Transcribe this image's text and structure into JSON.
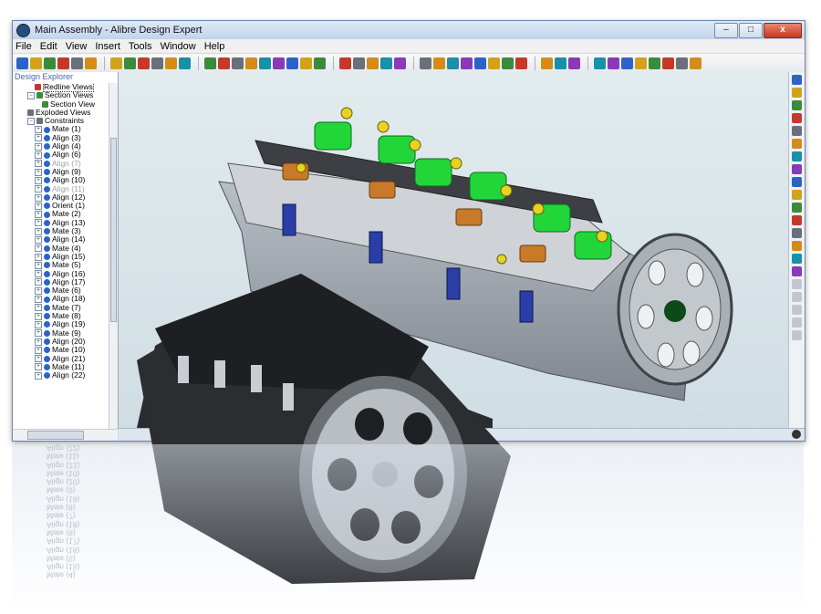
{
  "window": {
    "title": "Main Assembly - Alibre Design Expert",
    "controls": {
      "minimize": "–",
      "maximize": "□",
      "close": "x"
    }
  },
  "menu": [
    "File",
    "Edit",
    "View",
    "Insert",
    "Tools",
    "Window",
    "Help"
  ],
  "explorer": {
    "title": "Design Explorer",
    "items": [
      {
        "label": "Redline Views",
        "icon": "redline-icon",
        "indent": 3,
        "expander": "",
        "state": "selected"
      },
      {
        "label": "Section Views",
        "icon": "section-views-icon",
        "indent": 2,
        "expander": "−",
        "state": ""
      },
      {
        "label": "Section View",
        "icon": "section-view-icon",
        "indent": 4,
        "expander": "",
        "state": ""
      },
      {
        "label": "Exploded Views",
        "icon": "exploded-views-icon",
        "indent": 2,
        "expander": "",
        "state": ""
      },
      {
        "label": "Constraints",
        "icon": "constraints-icon",
        "indent": 2,
        "expander": "−",
        "state": ""
      },
      {
        "label": "Mate (1)",
        "icon": "mate-icon",
        "indent": 3,
        "expander": "+",
        "state": ""
      },
      {
        "label": "Align (3)",
        "icon": "align-icon",
        "indent": 3,
        "expander": "+",
        "state": ""
      },
      {
        "label": "Align (4)",
        "icon": "align-icon",
        "indent": 3,
        "expander": "+",
        "state": ""
      },
      {
        "label": "Align (6)",
        "icon": "align-icon",
        "indent": 3,
        "expander": "+",
        "state": ""
      },
      {
        "label": "Align (7)",
        "icon": "align-icon",
        "indent": 3,
        "expander": "+",
        "state": "dim"
      },
      {
        "label": "Align (9)",
        "icon": "align-icon",
        "indent": 3,
        "expander": "+",
        "state": ""
      },
      {
        "label": "Align (10)",
        "icon": "align-icon",
        "indent": 3,
        "expander": "+",
        "state": ""
      },
      {
        "label": "Align (11)",
        "icon": "align-icon",
        "indent": 3,
        "expander": "+",
        "state": "dim"
      },
      {
        "label": "Align (12)",
        "icon": "align-icon",
        "indent": 3,
        "expander": "+",
        "state": ""
      },
      {
        "label": "Orient (1)",
        "icon": "orient-icon",
        "indent": 3,
        "expander": "+",
        "state": ""
      },
      {
        "label": "Mate (2)",
        "icon": "mate-icon",
        "indent": 3,
        "expander": "+",
        "state": ""
      },
      {
        "label": "Align (13)",
        "icon": "align-icon",
        "indent": 3,
        "expander": "+",
        "state": ""
      },
      {
        "label": "Mate (3)",
        "icon": "mate-icon",
        "indent": 3,
        "expander": "+",
        "state": ""
      },
      {
        "label": "Align (14)",
        "icon": "align-icon",
        "indent": 3,
        "expander": "+",
        "state": ""
      },
      {
        "label": "Mate (4)",
        "icon": "mate-icon",
        "indent": 3,
        "expander": "+",
        "state": ""
      },
      {
        "label": "Align (15)",
        "icon": "align-icon",
        "indent": 3,
        "expander": "+",
        "state": ""
      },
      {
        "label": "Mate (5)",
        "icon": "mate-icon",
        "indent": 3,
        "expander": "+",
        "state": ""
      },
      {
        "label": "Align (16)",
        "icon": "align-icon",
        "indent": 3,
        "expander": "+",
        "state": ""
      },
      {
        "label": "Align (17)",
        "icon": "align-icon",
        "indent": 3,
        "expander": "+",
        "state": ""
      },
      {
        "label": "Mate (6)",
        "icon": "mate-icon",
        "indent": 3,
        "expander": "+",
        "state": ""
      },
      {
        "label": "Align (18)",
        "icon": "align-icon",
        "indent": 3,
        "expander": "+",
        "state": ""
      },
      {
        "label": "Mate (7)",
        "icon": "mate-icon",
        "indent": 3,
        "expander": "+",
        "state": ""
      },
      {
        "label": "Mate (8)",
        "icon": "mate-icon",
        "indent": 3,
        "expander": "+",
        "state": ""
      },
      {
        "label": "Align (19)",
        "icon": "align-icon",
        "indent": 3,
        "expander": "+",
        "state": ""
      },
      {
        "label": "Mate (9)",
        "icon": "mate-icon",
        "indent": 3,
        "expander": "+",
        "state": ""
      },
      {
        "label": "Align (20)",
        "icon": "align-icon",
        "indent": 3,
        "expander": "+",
        "state": ""
      },
      {
        "label": "Mate (10)",
        "icon": "mate-icon",
        "indent": 3,
        "expander": "+",
        "state": ""
      },
      {
        "label": "Align (21)",
        "icon": "align-icon",
        "indent": 3,
        "expander": "+",
        "state": ""
      },
      {
        "label": "Mate (11)",
        "icon": "mate-icon",
        "indent": 3,
        "expander": "+",
        "state": ""
      },
      {
        "label": "Align (22)",
        "icon": "align-icon",
        "indent": 3,
        "expander": "+",
        "state": ""
      }
    ]
  },
  "toolbar_groups": [
    [
      "new-file-icon",
      "open-file-icon",
      "save-icon",
      "open-folder-icon",
      "print-preview-icon",
      "print-icon"
    ],
    [
      "cut-icon",
      "copy-icon",
      "paste-icon",
      "delete-icon",
      "undo-icon",
      "redo-icon"
    ],
    [
      "view-front-icon",
      "view-back-icon",
      "view-left-icon",
      "view-right-icon",
      "view-top-icon",
      "view-bottom-icon",
      "view-iso-icon",
      "rotate-view-icon",
      "flip-view-icon"
    ],
    [
      "section-icon",
      "explode-icon",
      "material-icon",
      "design-icon",
      "analyze-icon"
    ],
    [
      "select-icon",
      "box-select-icon",
      "lasso-icon",
      "zoom-icon",
      "zoom-window-icon",
      "zoom-fit-icon",
      "back-view-icon",
      "forward-view-icon"
    ],
    [
      "constraint-icon",
      "measure-icon",
      "render-icon"
    ],
    [
      "insert-part-icon",
      "sketch-icon",
      "dimension-icon",
      "table-icon",
      "color-icon",
      "check-icon",
      "balance-icon",
      "link-icon"
    ]
  ],
  "right_toolbar": [
    "part-insert-icon",
    "subassembly-icon",
    "constraint-mate-icon",
    "align-tool-icon",
    "pattern-icon",
    "dot-icon",
    "sphere-icon",
    "replace-icon",
    "color-part-icon",
    "dot-icon-2",
    "paint-icon",
    "exploded-icon",
    "view-rotate-icon",
    "function-icon",
    "bom-icon",
    "edit-icon",
    "grayed-icon-1",
    "grayed-icon-2",
    "grayed-icon-3",
    "grayed-icon-4",
    "grayed-icon-5"
  ],
  "colors": {
    "viewport_bg": "#d6e2e6",
    "cam_green": "#22d63a",
    "rocker_orange": "#c97a29",
    "spring_blue": "#2b3ea8",
    "bolt_yellow": "#e7d321",
    "head_gray": "#9aa1a8",
    "render_black": "#2a2c30"
  }
}
